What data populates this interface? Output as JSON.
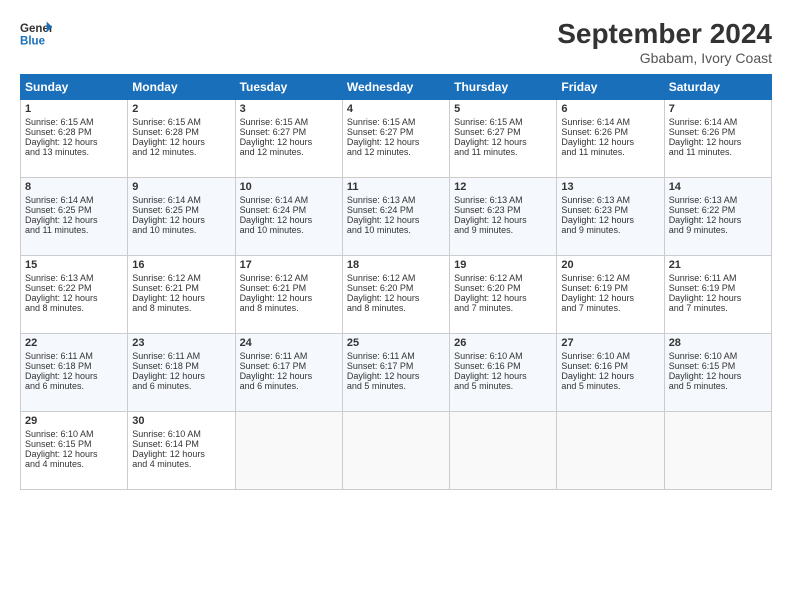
{
  "logo": {
    "general": "General",
    "blue": "Blue"
  },
  "title": "September 2024",
  "subtitle": "Gbabam, Ivory Coast",
  "days_of_week": [
    "Sunday",
    "Monday",
    "Tuesday",
    "Wednesday",
    "Thursday",
    "Friday",
    "Saturday"
  ],
  "weeks": [
    [
      {
        "day": 1,
        "lines": [
          "Sunrise: 6:15 AM",
          "Sunset: 6:28 PM",
          "Daylight: 12 hours",
          "and 13 minutes."
        ]
      },
      {
        "day": 2,
        "lines": [
          "Sunrise: 6:15 AM",
          "Sunset: 6:28 PM",
          "Daylight: 12 hours",
          "and 12 minutes."
        ]
      },
      {
        "day": 3,
        "lines": [
          "Sunrise: 6:15 AM",
          "Sunset: 6:27 PM",
          "Daylight: 12 hours",
          "and 12 minutes."
        ]
      },
      {
        "day": 4,
        "lines": [
          "Sunrise: 6:15 AM",
          "Sunset: 6:27 PM",
          "Daylight: 12 hours",
          "and 12 minutes."
        ]
      },
      {
        "day": 5,
        "lines": [
          "Sunrise: 6:15 AM",
          "Sunset: 6:27 PM",
          "Daylight: 12 hours",
          "and 11 minutes."
        ]
      },
      {
        "day": 6,
        "lines": [
          "Sunrise: 6:14 AM",
          "Sunset: 6:26 PM",
          "Daylight: 12 hours",
          "and 11 minutes."
        ]
      },
      {
        "day": 7,
        "lines": [
          "Sunrise: 6:14 AM",
          "Sunset: 6:26 PM",
          "Daylight: 12 hours",
          "and 11 minutes."
        ]
      }
    ],
    [
      {
        "day": 8,
        "lines": [
          "Sunrise: 6:14 AM",
          "Sunset: 6:25 PM",
          "Daylight: 12 hours",
          "and 11 minutes."
        ]
      },
      {
        "day": 9,
        "lines": [
          "Sunrise: 6:14 AM",
          "Sunset: 6:25 PM",
          "Daylight: 12 hours",
          "and 10 minutes."
        ]
      },
      {
        "day": 10,
        "lines": [
          "Sunrise: 6:14 AM",
          "Sunset: 6:24 PM",
          "Daylight: 12 hours",
          "and 10 minutes."
        ]
      },
      {
        "day": 11,
        "lines": [
          "Sunrise: 6:13 AM",
          "Sunset: 6:24 PM",
          "Daylight: 12 hours",
          "and 10 minutes."
        ]
      },
      {
        "day": 12,
        "lines": [
          "Sunrise: 6:13 AM",
          "Sunset: 6:23 PM",
          "Daylight: 12 hours",
          "and 9 minutes."
        ]
      },
      {
        "day": 13,
        "lines": [
          "Sunrise: 6:13 AM",
          "Sunset: 6:23 PM",
          "Daylight: 12 hours",
          "and 9 minutes."
        ]
      },
      {
        "day": 14,
        "lines": [
          "Sunrise: 6:13 AM",
          "Sunset: 6:22 PM",
          "Daylight: 12 hours",
          "and 9 minutes."
        ]
      }
    ],
    [
      {
        "day": 15,
        "lines": [
          "Sunrise: 6:13 AM",
          "Sunset: 6:22 PM",
          "Daylight: 12 hours",
          "and 8 minutes."
        ]
      },
      {
        "day": 16,
        "lines": [
          "Sunrise: 6:12 AM",
          "Sunset: 6:21 PM",
          "Daylight: 12 hours",
          "and 8 minutes."
        ]
      },
      {
        "day": 17,
        "lines": [
          "Sunrise: 6:12 AM",
          "Sunset: 6:21 PM",
          "Daylight: 12 hours",
          "and 8 minutes."
        ]
      },
      {
        "day": 18,
        "lines": [
          "Sunrise: 6:12 AM",
          "Sunset: 6:20 PM",
          "Daylight: 12 hours",
          "and 8 minutes."
        ]
      },
      {
        "day": 19,
        "lines": [
          "Sunrise: 6:12 AM",
          "Sunset: 6:20 PM",
          "Daylight: 12 hours",
          "and 7 minutes."
        ]
      },
      {
        "day": 20,
        "lines": [
          "Sunrise: 6:12 AM",
          "Sunset: 6:19 PM",
          "Daylight: 12 hours",
          "and 7 minutes."
        ]
      },
      {
        "day": 21,
        "lines": [
          "Sunrise: 6:11 AM",
          "Sunset: 6:19 PM",
          "Daylight: 12 hours",
          "and 7 minutes."
        ]
      }
    ],
    [
      {
        "day": 22,
        "lines": [
          "Sunrise: 6:11 AM",
          "Sunset: 6:18 PM",
          "Daylight: 12 hours",
          "and 6 minutes."
        ]
      },
      {
        "day": 23,
        "lines": [
          "Sunrise: 6:11 AM",
          "Sunset: 6:18 PM",
          "Daylight: 12 hours",
          "and 6 minutes."
        ]
      },
      {
        "day": 24,
        "lines": [
          "Sunrise: 6:11 AM",
          "Sunset: 6:17 PM",
          "Daylight: 12 hours",
          "and 6 minutes."
        ]
      },
      {
        "day": 25,
        "lines": [
          "Sunrise: 6:11 AM",
          "Sunset: 6:17 PM",
          "Daylight: 12 hours",
          "and 5 minutes."
        ]
      },
      {
        "day": 26,
        "lines": [
          "Sunrise: 6:10 AM",
          "Sunset: 6:16 PM",
          "Daylight: 12 hours",
          "and 5 minutes."
        ]
      },
      {
        "day": 27,
        "lines": [
          "Sunrise: 6:10 AM",
          "Sunset: 6:16 PM",
          "Daylight: 12 hours",
          "and 5 minutes."
        ]
      },
      {
        "day": 28,
        "lines": [
          "Sunrise: 6:10 AM",
          "Sunset: 6:15 PM",
          "Daylight: 12 hours",
          "and 5 minutes."
        ]
      }
    ],
    [
      {
        "day": 29,
        "lines": [
          "Sunrise: 6:10 AM",
          "Sunset: 6:15 PM",
          "Daylight: 12 hours",
          "and 4 minutes."
        ]
      },
      {
        "day": 30,
        "lines": [
          "Sunrise: 6:10 AM",
          "Sunset: 6:14 PM",
          "Daylight: 12 hours",
          "and 4 minutes."
        ]
      },
      null,
      null,
      null,
      null,
      null
    ]
  ]
}
